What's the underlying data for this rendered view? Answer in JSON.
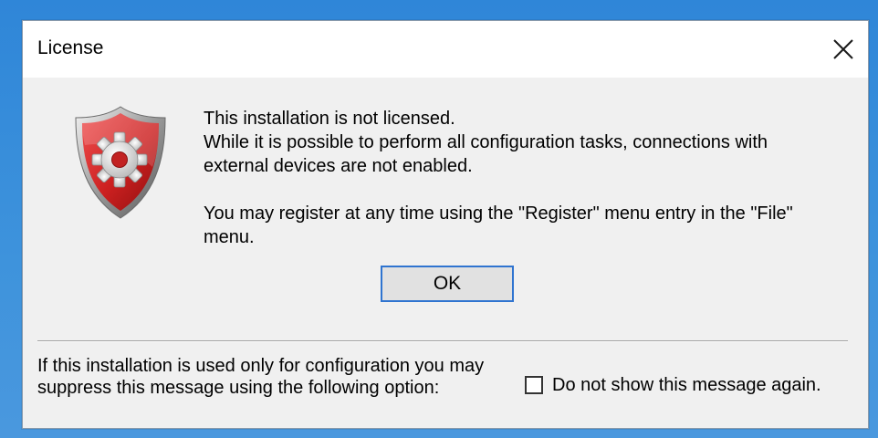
{
  "dialog": {
    "title": "License",
    "close_icon": "close-icon",
    "shield_icon": "gear-shield-icon",
    "colors": {
      "desktop": "#3d8ed6",
      "dialog_bg": "#f0f0f0",
      "titlebar_bg": "#ffffff",
      "ok_border": "#2f74d0",
      "shield_red": "#d32a2a"
    },
    "message": {
      "line1": "This installation is not licensed.",
      "line2": "While it is possible to perform all configuration tasks, connections with",
      "line3": "external devices are not enabled.",
      "line4": "You may register at any time using the \"Register\" menu entry in the \"File\"",
      "line5": "menu."
    },
    "ok_label": "OK",
    "hint": {
      "line1": "If this installation is used only for configuration you may",
      "line2": "suppress this message using the following option:"
    },
    "checkbox": {
      "label": "Do not show this message again.",
      "checked": false
    }
  }
}
